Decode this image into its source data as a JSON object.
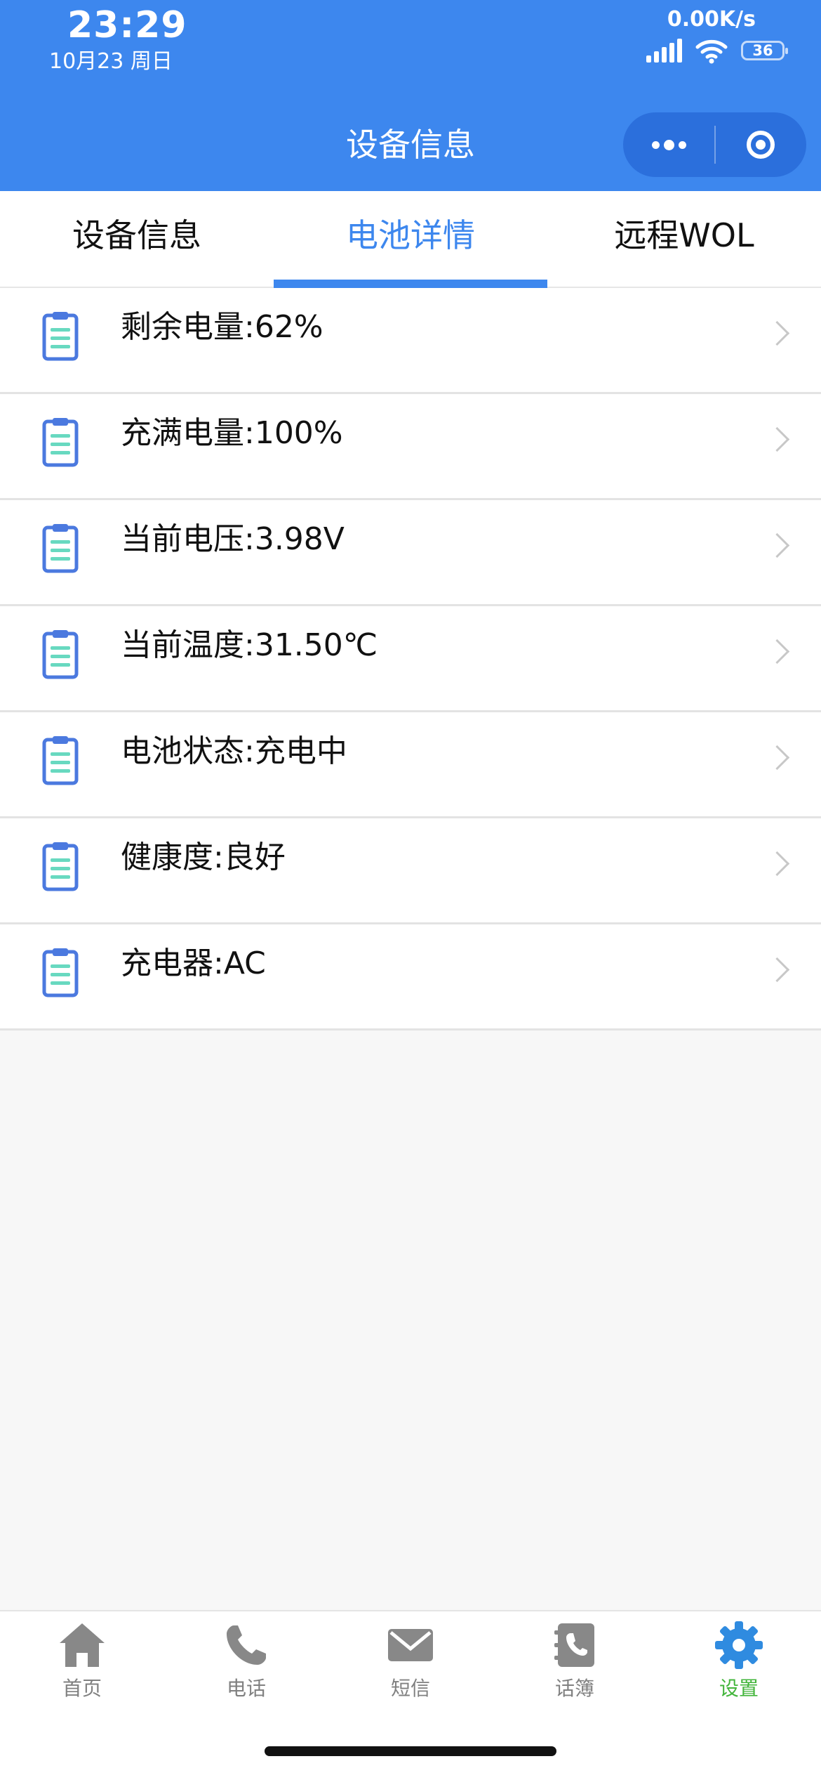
{
  "status_bar": {
    "time": "23:29",
    "date": "10月23 周日",
    "net_speed": "0.00K/s",
    "battery": "36"
  },
  "header": {
    "title": "设备信息",
    "accent_color": "#3d87ee"
  },
  "tabs": [
    {
      "label": "设备信息",
      "active": false
    },
    {
      "label": "电池详情",
      "active": true
    },
    {
      "label": "远程WOL",
      "active": false
    }
  ],
  "battery_list": [
    {
      "label": "剩余电量:62%",
      "icon": "clipboard-icon"
    },
    {
      "label": "充满电量:100%",
      "icon": "clipboard-icon"
    },
    {
      "label": "当前电压:3.98V",
      "icon": "clipboard-icon"
    },
    {
      "label": "当前温度:31.50℃",
      "icon": "clipboard-icon"
    },
    {
      "label": "电池状态:充电中",
      "icon": "clipboard-icon"
    },
    {
      "label": "健康度:良好",
      "icon": "clipboard-icon"
    },
    {
      "label": "充电器:AC",
      "icon": "clipboard-icon"
    }
  ],
  "bottom_nav": [
    {
      "label": "首页",
      "icon": "home-icon",
      "active": false
    },
    {
      "label": "电话",
      "icon": "phone-icon",
      "active": false
    },
    {
      "label": "短信",
      "icon": "mail-icon",
      "active": false
    },
    {
      "label": "话簿",
      "icon": "contacts-icon",
      "active": false
    },
    {
      "label": "设置",
      "icon": "gear-icon",
      "active": true
    }
  ],
  "colors": {
    "inactive_nav": "#808080",
    "active_nav": "#43b53c"
  }
}
